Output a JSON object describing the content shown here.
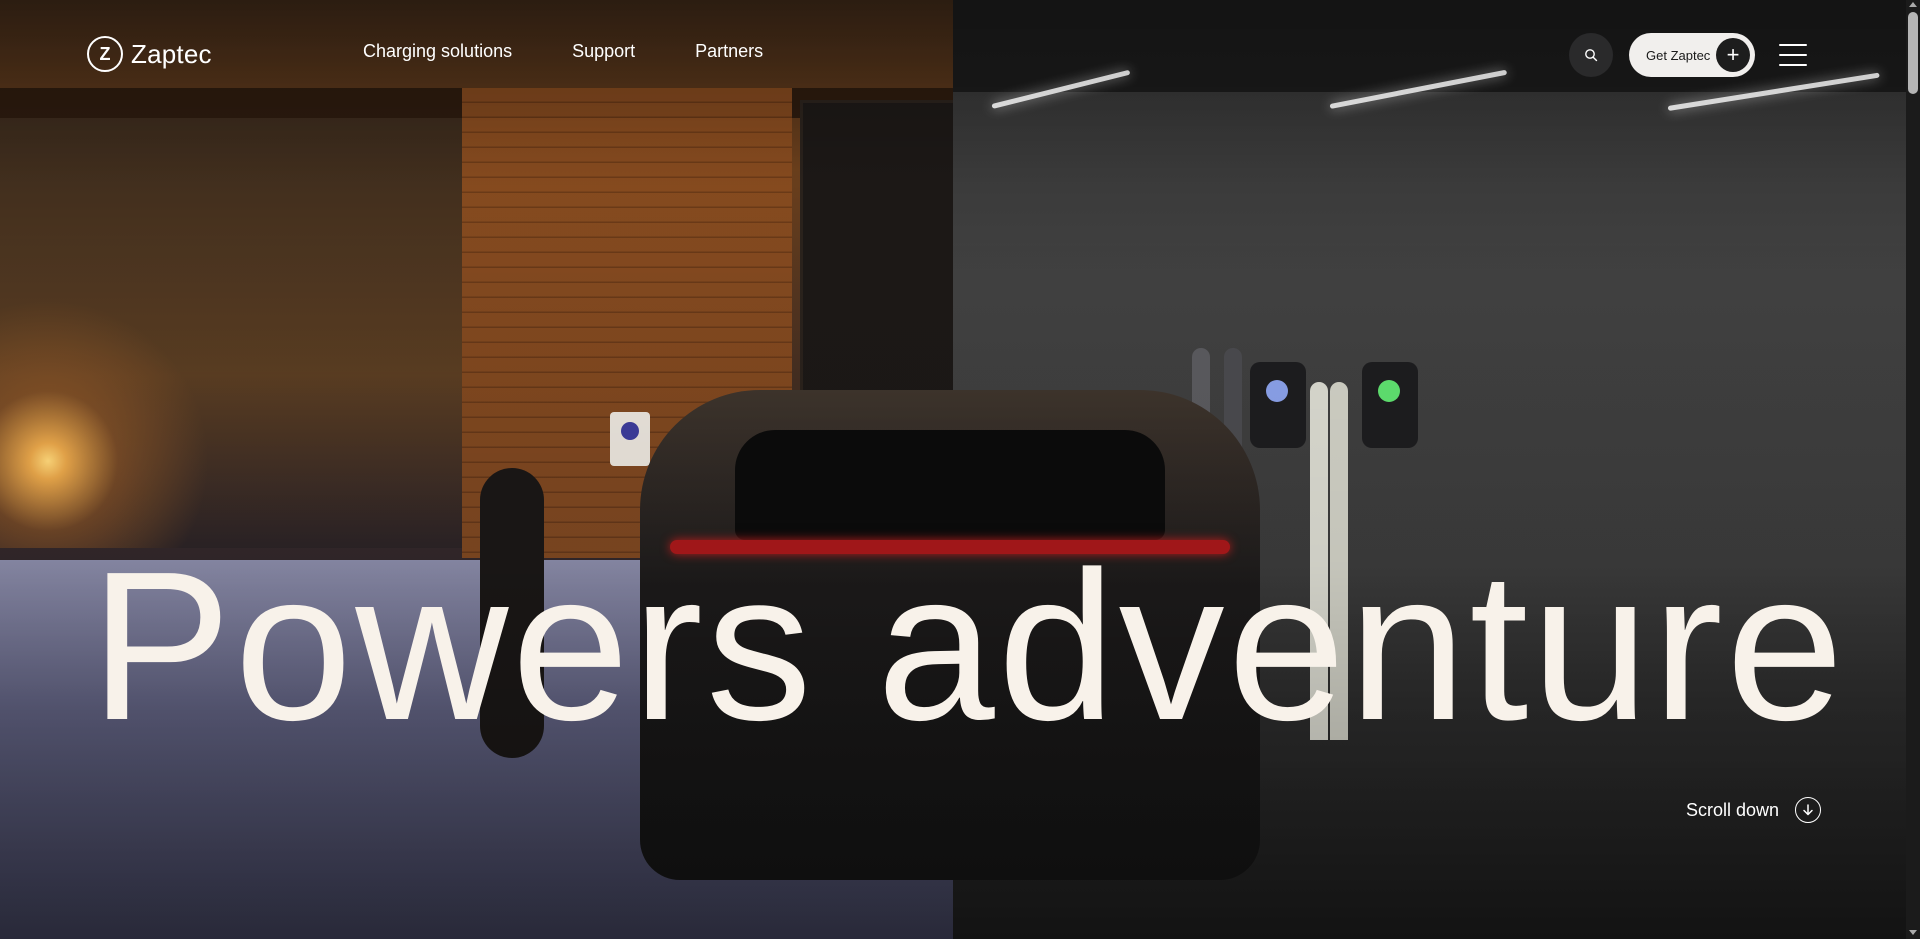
{
  "header": {
    "logo_text": "Zaptec",
    "logo_mark": "Z",
    "nav": [
      {
        "label": "Charging solutions"
      },
      {
        "label": "Support"
      },
      {
        "label": "Partners"
      }
    ],
    "search_icon": "search-icon",
    "cta_label": "Get Zaptec",
    "cta_icon": "+",
    "menu_icon": "hamburger-menu-icon"
  },
  "hero": {
    "headline": "Powers adventure",
    "scroll_label": "Scroll down",
    "scroll_icon": "arrow-down-circle-icon",
    "colors": {
      "headline": "#f8f2ea",
      "cta_bg": "#f1efed",
      "tail_light": "#a8181a"
    }
  }
}
